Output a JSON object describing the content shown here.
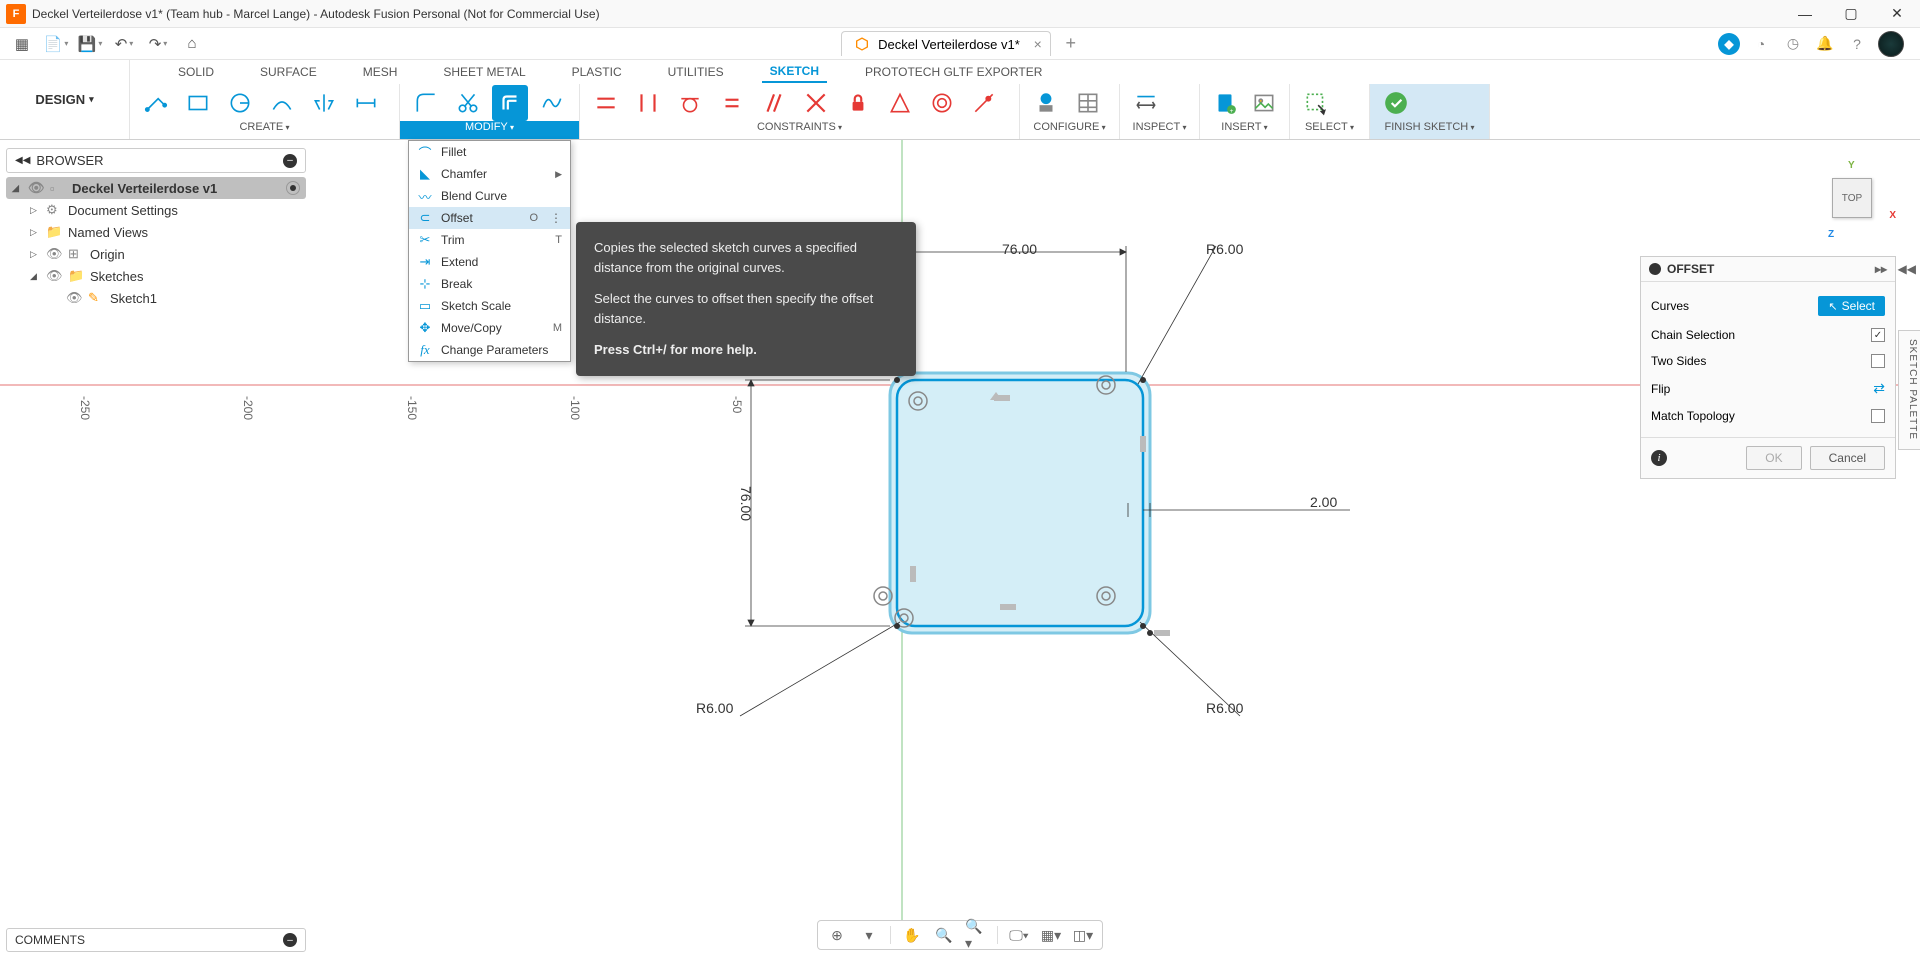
{
  "titlebar": {
    "app_initial": "F",
    "title": "Deckel Verteilerdose v1* (Team hub - Marcel Lange) - Autodesk Fusion Personal (Not for Commercial Use)"
  },
  "doc_tab": {
    "name": "Deckel Verteilerdose v1*"
  },
  "design_label": "DESIGN",
  "ribbon_tabs": [
    "SOLID",
    "SURFACE",
    "MESH",
    "SHEET METAL",
    "PLASTIC",
    "UTILITIES",
    "SKETCH",
    "PROTOTECH GLTF EXPORTER"
  ],
  "ribbon_active": "SKETCH",
  "tool_groups": {
    "create": "CREATE",
    "modify": "MODIFY",
    "constraints": "CONSTRAINTS",
    "configure": "CONFIGURE",
    "inspect": "INSPECT",
    "insert": "INSERT",
    "select": "SELECT",
    "finish": "FINISH SKETCH"
  },
  "browser": {
    "header": "BROWSER",
    "root": "Deckel Verteilerdose v1",
    "items": [
      {
        "label": "Document Settings",
        "icon": "gear"
      },
      {
        "label": "Named Views",
        "icon": "folder"
      },
      {
        "label": "Origin",
        "icon": "origin"
      },
      {
        "label": "Sketches",
        "icon": "folder",
        "expanded": true,
        "children": [
          {
            "label": "Sketch1",
            "icon": "sketch"
          }
        ]
      }
    ]
  },
  "modify_menu": {
    "label": "MODIFY",
    "items": [
      {
        "label": "Fillet",
        "shortcut": "",
        "icon": "fillet"
      },
      {
        "label": "Chamfer",
        "shortcut": "",
        "icon": "chamfer",
        "submenu": true
      },
      {
        "label": "Blend Curve",
        "shortcut": "",
        "icon": "blend"
      },
      {
        "label": "Offset",
        "shortcut": "O",
        "icon": "offset",
        "selected": true,
        "more": true
      },
      {
        "label": "Trim",
        "shortcut": "T",
        "icon": "trim"
      },
      {
        "label": "Extend",
        "shortcut": "",
        "icon": "extend"
      },
      {
        "label": "Break",
        "shortcut": "",
        "icon": "break"
      },
      {
        "label": "Sketch Scale",
        "shortcut": "",
        "icon": "scale"
      },
      {
        "label": "Move/Copy",
        "shortcut": "M",
        "icon": "move"
      },
      {
        "label": "Change Parameters",
        "shortcut": "",
        "icon": "fx"
      }
    ]
  },
  "tooltip": {
    "p1": "Copies the selected sketch curves a specified distance from the original curves.",
    "p2": "Select the curves to offset then specify the offset distance.",
    "help": "Press Ctrl+/ for more help."
  },
  "offset_panel": {
    "title": "OFFSET",
    "rows": {
      "curves": "Curves",
      "select": "Select",
      "chain": "Chain Selection",
      "two_sides": "Two Sides",
      "flip": "Flip",
      "match": "Match Topology"
    },
    "ok": "OK",
    "cancel": "Cancel"
  },
  "sketch_palette_label": "SKETCH PALETTE",
  "viewcube_face": "TOP",
  "comments_label": "COMMENTS",
  "dimensions": {
    "top_width": "76.00",
    "top_radius": "R6.00",
    "left_height": "76.00",
    "offset_val": "2.00",
    "bl_radius": "R6.00",
    "br_radius": "R6.00"
  },
  "ruler": [
    "-250",
    "-200",
    "-150",
    "-100",
    "-50"
  ]
}
